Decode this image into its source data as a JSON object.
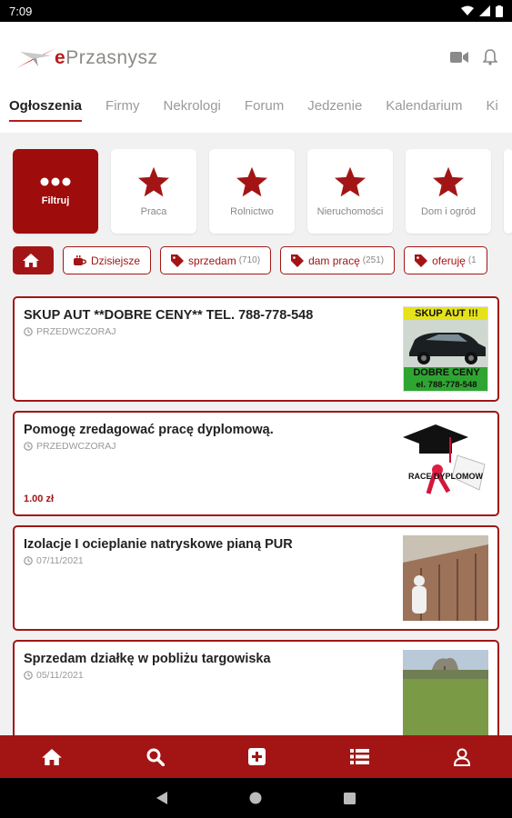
{
  "status": {
    "time": "7:09"
  },
  "header": {
    "logo_text_e": "e",
    "logo_text_rest": "Przasnysz"
  },
  "tabs": [
    {
      "label": "Ogłoszenia",
      "active": true
    },
    {
      "label": "Firmy"
    },
    {
      "label": "Nekrologi"
    },
    {
      "label": "Forum"
    },
    {
      "label": "Jedzenie"
    },
    {
      "label": "Kalendarium"
    },
    {
      "label": "Ki"
    }
  ],
  "categories": [
    {
      "label": "Filtruj",
      "icon": "dots-icon"
    },
    {
      "label": "Praca",
      "icon": "star-icon"
    },
    {
      "label": "Rolnictwo",
      "icon": "star-icon"
    },
    {
      "label": "Nieruchomości",
      "icon": "star-icon"
    },
    {
      "label": "Dom i ogród",
      "icon": "star-icon"
    },
    {
      "label": "",
      "icon": "star-icon"
    }
  ],
  "chips": [
    {
      "label": "Dzisiejsze",
      "icon": "coffee-icon"
    },
    {
      "label": "sprzedam",
      "count": "(710)",
      "icon": "tag-icon"
    },
    {
      "label": "dam pracę",
      "count": "(251)",
      "icon": "tag-icon"
    },
    {
      "label": "oferuję",
      "count": "(1",
      "icon": "tag-icon"
    }
  ],
  "listings": [
    {
      "title": "SKUP AUT **DOBRE CENY** TEL. 788-778-548",
      "date": "PRZEDWCZORAJ",
      "price": "",
      "thumb_text_top": "SKUP AUT !!!",
      "thumb_text_mid": "DOBRE CENY",
      "thumb_text_bot": "el. 788-778-548"
    },
    {
      "title": "Pomogę zredagować pracę dyplomową.",
      "date": "PRZEDWCZORAJ",
      "price": "1.00 zł",
      "thumb_text": "RACE DYPLOMOW"
    },
    {
      "title": "Izolacje I ocieplanie natryskowe pianą PUR",
      "date": "07/11/2021",
      "price": ""
    },
    {
      "title": "Sprzedam działkę w pobliżu targowiska",
      "date": "05/11/2021",
      "price": ""
    }
  ],
  "colors": {
    "brand": "#a31515",
    "brand_dark": "#9f0c0c"
  }
}
